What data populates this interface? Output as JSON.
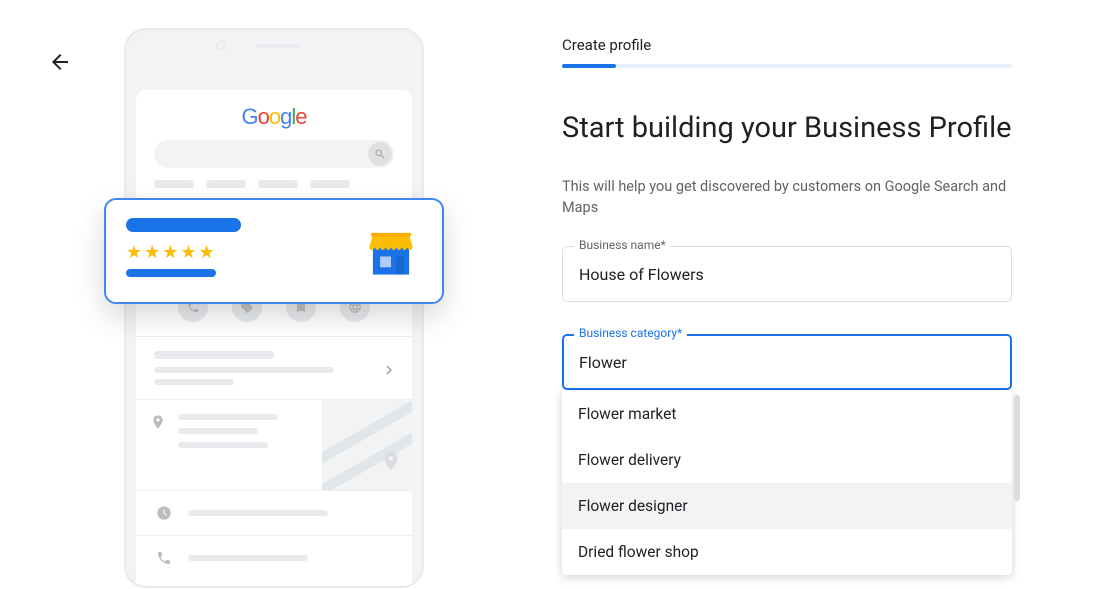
{
  "nav": {
    "back_icon": "back-arrow"
  },
  "illustration": {
    "logo_letters": [
      "G",
      "o",
      "o",
      "g",
      "l",
      "e"
    ]
  },
  "stepper": {
    "label": "Create profile",
    "progress_percent": 12
  },
  "form": {
    "headline": "Start building your Business Profile",
    "subtext": "This will help you get discovered by customers on Google Search and Maps",
    "business_name": {
      "label": "Business name*",
      "value": "House of Flowers"
    },
    "business_category": {
      "label": "Business category*",
      "value": "Flower",
      "suggestions": [
        {
          "label": "Flower market",
          "highlighted": false
        },
        {
          "label": "Flower delivery",
          "highlighted": false
        },
        {
          "label": "Flower designer",
          "highlighted": true
        },
        {
          "label": "Dried flower shop",
          "highlighted": false
        }
      ]
    }
  }
}
